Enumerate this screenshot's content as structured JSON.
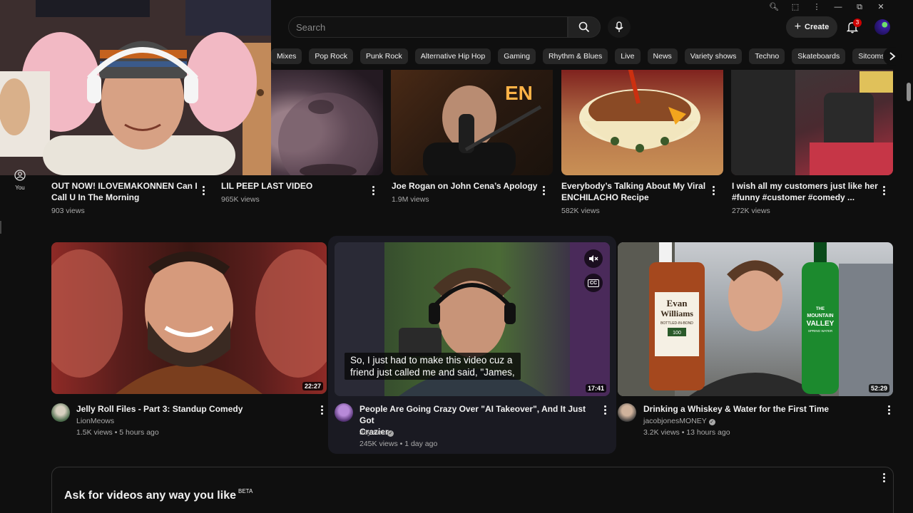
{
  "search": {
    "placeholder": "Search"
  },
  "header": {
    "create_label": "Create",
    "notification_count": "3",
    "icons": [
      "search-icon",
      "mic-icon",
      "plus-icon",
      "bell-icon",
      "zoom-icon",
      "extensions-icon",
      "more-icon",
      "minimize-icon",
      "restore-icon",
      "close-icon"
    ]
  },
  "chips": [
    "Mixes",
    "Pop Rock",
    "Punk Rock",
    "Alternative Hip Hop",
    "Gaming",
    "Rhythm & Blues",
    "Live",
    "News",
    "Variety shows",
    "Techno",
    "Skateboards",
    "Sitcoms"
  ],
  "sidebar": {
    "you_label": "You"
  },
  "row1": [
    {
      "title1": "OUT NOW! ILOVEMAKONNEN Can I",
      "title2": "Call U In The Morning",
      "views": "903 views"
    },
    {
      "title1": "LIL PEEP LAST VIDEO",
      "title2": "",
      "views": "965K views"
    },
    {
      "title1": "Joe Rogan on John Cena’s Apology",
      "title2": "",
      "views": "1.9M views"
    },
    {
      "title1": "Everybody’s Talking About My Viral",
      "title2": "ENCHILACHO Recipe",
      "views": "582K views"
    },
    {
      "title1": "I wish all my customers just like her",
      "title2": "#funny #customer #comedy ...",
      "views": "272K views"
    }
  ],
  "row2": [
    {
      "title1": "Jelly Roll Files - Part 3: Standup Comedy",
      "title2": "",
      "channel": "LionMeows",
      "meta": "1.5K views • 5 hours ago",
      "duration": "22:27"
    },
    {
      "title1": "People Are Going Crazy Over \"AI Takeover\", And It Just Got",
      "title2": "Crazier",
      "channel": "Jaymez",
      "meta": "245K views • 1 day ago",
      "duration": "17:41",
      "caption1": "So, I just had to make this video cuz a",
      "caption2": "friend just called me and said, \"James,"
    },
    {
      "title1": "Drinking a Whiskey & Water for the First Time",
      "title2": "",
      "channel": "jacobjonesMONEY",
      "meta": "3.2K views • 13 hours ago",
      "duration": "52:29"
    }
  ],
  "thumb_text": {
    "peep_sign": "EN",
    "bottle_brand1": "Evan",
    "bottle_brand2": "Williams",
    "bottle_sub": "BOTTLED-IN-BOND",
    "bottle_num": "100",
    "water_brand1": "THE",
    "water_brand2": "MOUNTAIN",
    "water_brand3": "VALLEY",
    "water_sub": "SPRING WATER"
  },
  "ask": {
    "title": "Ask for videos any way you like",
    "badge": "BETA"
  },
  "colors": {
    "background": "#0f0f0f",
    "chip": "#272727",
    "badge": "#cc0000",
    "meta_text": "#aaaaaa"
  }
}
